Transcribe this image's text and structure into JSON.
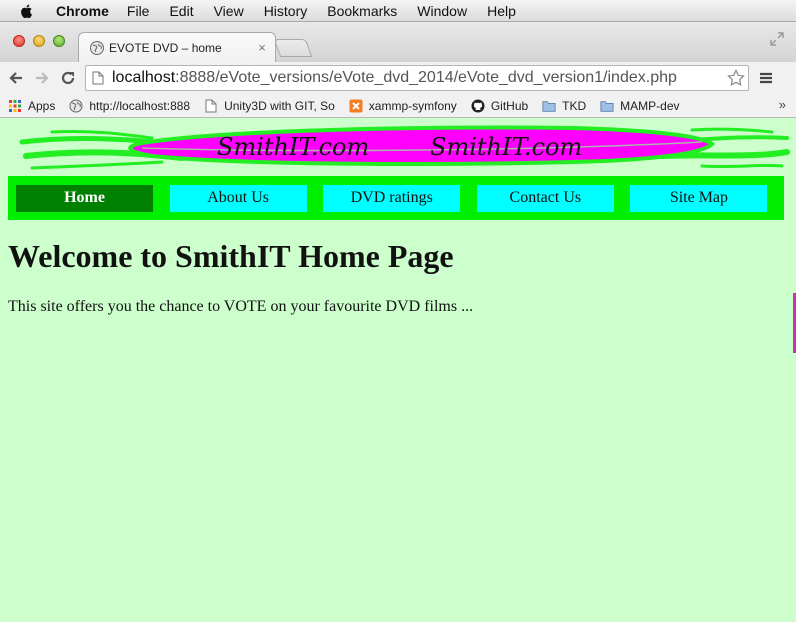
{
  "system_menubar": {
    "app_name": "Chrome",
    "menus": [
      "File",
      "Edit",
      "View",
      "History",
      "Bookmarks",
      "Window",
      "Help"
    ]
  },
  "browser": {
    "tab": {
      "title": "EVOTE DVD – home",
      "close_glyph": "×"
    },
    "url": {
      "host": "localhost",
      "rest": ":8888/eVote_versions/eVote_dvd_2014/eVote_dvd_version1/index.php"
    },
    "bookmarks": [
      {
        "label": "Apps",
        "icon": "apps-grid-icon"
      },
      {
        "label": "http://localhost:888",
        "icon": "globe-icon"
      },
      {
        "label": "Unity3D with GIT, So",
        "icon": "page-icon"
      },
      {
        "label": "xammp-symfony",
        "icon": "xampp-icon"
      },
      {
        "label": "GitHub",
        "icon": "github-icon"
      },
      {
        "label": "TKD",
        "icon": "folder-icon"
      },
      {
        "label": "MAMP-dev",
        "icon": "folder-icon"
      }
    ],
    "bookmarks_overflow": "»"
  },
  "page": {
    "banner": {
      "text_left": "SmithIT.com",
      "text_right": "SmithIT.com"
    },
    "nav": {
      "items": [
        {
          "label": "Home",
          "active": true
        },
        {
          "label": "About Us",
          "active": false
        },
        {
          "label": "DVD ratings",
          "active": false
        },
        {
          "label": "Contact Us",
          "active": false
        },
        {
          "label": "Site Map",
          "active": false
        }
      ]
    },
    "heading": "Welcome to SmithIT Home Page",
    "intro": "This site offers you the chance to VOTE on your favourite DVD films ..."
  },
  "colors": {
    "page_bg": "#ccffcc",
    "nav_bg": "#00ee00",
    "nav_item_bg": "#00ffff",
    "nav_item_active_bg": "#008000",
    "banner_green": "#22ee22",
    "banner_magenta": "#ff00ff"
  }
}
